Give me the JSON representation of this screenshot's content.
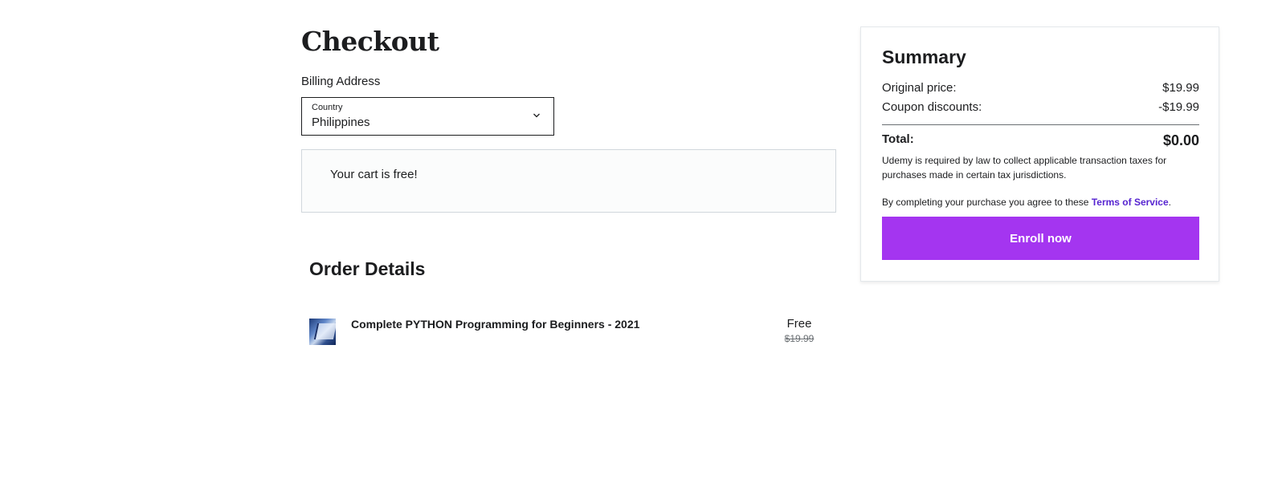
{
  "checkout": {
    "title": "Checkout",
    "billing_label": "Billing Address",
    "country_caption": "Country",
    "country_value": "Philippines",
    "free_message": "Your cart is free!"
  },
  "order": {
    "title": "Order Details",
    "items": [
      {
        "title": "Complete PYTHON Programming for Beginners - 2021",
        "price": "Free",
        "original_price": "$19.99"
      }
    ]
  },
  "summary": {
    "title": "Summary",
    "original_label": "Original price:",
    "original_value": "$19.99",
    "coupon_label": "Coupon discounts:",
    "coupon_value": "-$19.99",
    "total_label": "Total:",
    "total_value": "$0.00",
    "tax_note": "Udemy is required by law to collect applicable transaction taxes for purchases made in certain tax jurisdictions.",
    "agree_text": "By completing your purchase you agree to these ",
    "tos_link": "Terms of Service",
    "agree_suffix": ".",
    "enroll_label": "Enroll now"
  },
  "colors": {
    "accent": "#a435f0",
    "link": "#5624d0",
    "text": "#1c1d1f",
    "muted": "#6a6f73"
  },
  "icons": {
    "country_dropdown": "chevron-down-icon",
    "course_thumbnail": "course-thumbnail-image"
  }
}
